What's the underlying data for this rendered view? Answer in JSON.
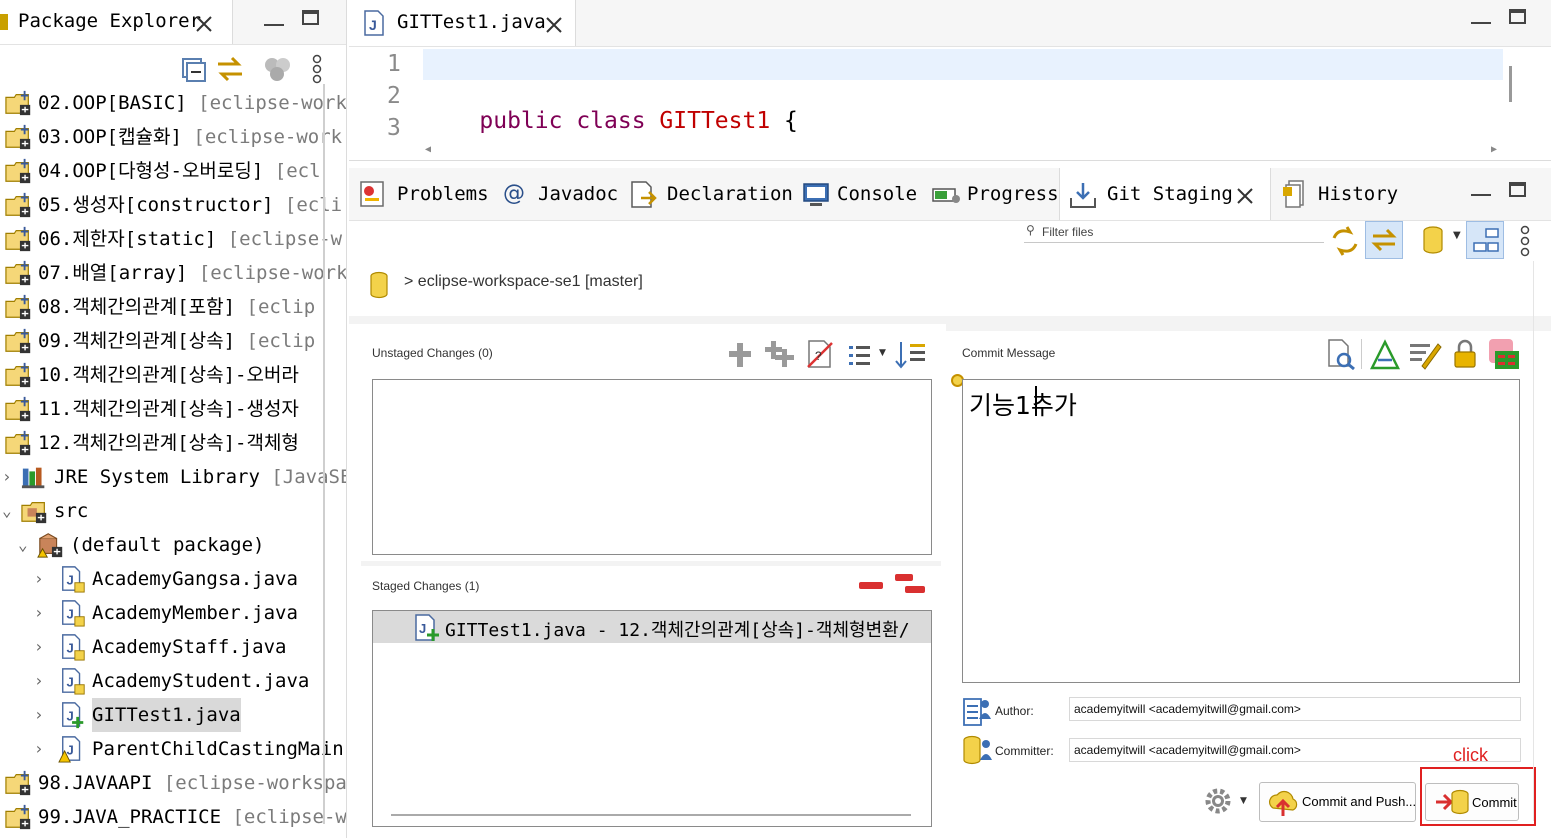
{
  "package_explorer": {
    "title": "Package Explorer",
    "items": [
      {
        "name": "02.OOP[BASIC]",
        "deco": "[eclipse-works",
        "icon": "java-project-warning-icon"
      },
      {
        "name": "03.OOP[캡슐화]",
        "deco": "[eclipse-work",
        "icon": "java-project-warning-icon"
      },
      {
        "name": "04.OOP[다형성-오버로딩]",
        "deco": "[ecl",
        "icon": "java-project-warning-icon"
      },
      {
        "name": "05.생성자[constructor]",
        "deco": "[ecli",
        "icon": "java-project-warning-icon"
      },
      {
        "name": "06.제한자[static]",
        "deco": "[eclipse-w",
        "icon": "java-project-warning-icon"
      },
      {
        "name": "07.배열[array]",
        "deco": "[eclipse-work",
        "icon": "java-project-warning-icon"
      },
      {
        "name": "08.객체간의관계[포함]",
        "deco": "[eclip",
        "icon": "java-project-warning-icon"
      },
      {
        "name": "09.객체간의관계[상속]",
        "deco": "[eclip",
        "icon": "java-project-warning-icon"
      },
      {
        "name": "10.객체간의관계[상속]-오버라",
        "deco": "",
        "icon": "java-project-warning-icon"
      },
      {
        "name": "11.객체간의관계[상속]-생성자",
        "deco": "",
        "icon": "java-project-warning-icon"
      },
      {
        "name": "12.객체간의관계[상속]-객체형",
        "deco": "",
        "icon": "java-project-changed-icon"
      },
      {
        "name": "JRE System Library",
        "deco": "[JavaSE-",
        "icon": "library-icon"
      },
      {
        "name": "src",
        "deco": "",
        "icon": "source-folder-icon"
      },
      {
        "name": "(default package)",
        "deco": "",
        "icon": "package-icon"
      },
      {
        "name": "AcademyGangsa.java",
        "deco": "",
        "icon": "java-file-icon"
      },
      {
        "name": "AcademyMember.java",
        "deco": "",
        "icon": "java-file-icon"
      },
      {
        "name": "AcademyStaff.java",
        "deco": "",
        "icon": "java-file-icon"
      },
      {
        "name": "AcademyStudent.java",
        "deco": "",
        "icon": "java-file-icon"
      },
      {
        "name": "GITTest1.java",
        "deco": "",
        "icon": "java-file-added-icon"
      },
      {
        "name": "ParentChildCastingMain.",
        "deco": "",
        "icon": "java-file-warning-icon"
      },
      {
        "name": "98.JAVAAPI",
        "deco": "[eclipse-workspac",
        "icon": "java-project-warning-icon"
      },
      {
        "name": "99.JAVA_PRACTICE",
        "deco": "[eclipse-wo",
        "icon": "java-project-warning-icon"
      }
    ]
  },
  "editor": {
    "tab_title": "GITTest1.java",
    "lines": [
      "1",
      "2",
      "3"
    ],
    "code_keyword": "public class ",
    "code_classname": "GITTest1",
    "code_brace": " {"
  },
  "views": {
    "tabs": [
      {
        "label": "Problems",
        "icon": "problems-icon"
      },
      {
        "label": "Javadoc",
        "icon": "javadoc-icon"
      },
      {
        "label": "Declaration",
        "icon": "declaration-icon"
      },
      {
        "label": "Console",
        "icon": "console-icon"
      },
      {
        "label": "Progress",
        "icon": "progress-icon"
      },
      {
        "label": "Git Staging",
        "icon": "git-staging-icon"
      },
      {
        "label": "History",
        "icon": "history-icon"
      }
    ]
  },
  "git_staging": {
    "filter_placeholder": "Filter files",
    "repo_label": "> eclipse-workspace-se1 [master]",
    "unstaged_title": "Unstaged Changes (0)",
    "staged_title": "Staged Changes (1)",
    "staged_files": [
      "GITTest1.java - 12.객체간의관계[상속]-객체형변환/"
    ],
    "commit_message_title": "Commit Message",
    "commit_message": "기능1추가",
    "author_label": "Author:",
    "author_value": "academyitwill <academyitwill@gmail.com>",
    "committer_label": "Committer:",
    "committer_value": "academyitwill <academyitwill@gmail.com>",
    "annotation": "click",
    "commit_and_push_label": "Commit and Push...",
    "commit_label": "Commit"
  },
  "colors": {
    "keyword": "#7f0055",
    "classname": "#c00000",
    "annotation": "#e02020",
    "highlight_line": "#e8f2fe"
  }
}
